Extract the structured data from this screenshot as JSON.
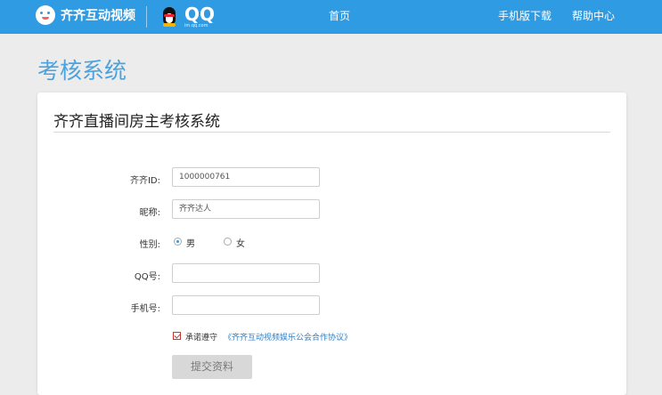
{
  "header": {
    "brand_name": "齐齐互动视频",
    "qq_logo_text": "QQ",
    "qq_logo_sub": "im.qq.com",
    "nav_home": "首页",
    "nav_mobile": "手机版下载",
    "nav_help": "帮助中心",
    "bar_color": "#2f9be2"
  },
  "page": {
    "title": "考核系统"
  },
  "card": {
    "title": "齐齐直播间房主考核系统"
  },
  "form": {
    "qiqi_id_label": "齐齐ID:",
    "qiqi_id_value": "1000000761",
    "nickname_label": "昵称:",
    "nickname_value": "齐齐达人",
    "gender_label": "性别:",
    "gender_male": "男",
    "gender_female": "女",
    "gender_selected": "男",
    "qq_label": "QQ号:",
    "qq_value": "",
    "phone_label": "手机号:",
    "phone_value": "",
    "agree_checked": true,
    "agree_text": "承诺遵守",
    "agree_link": "《齐齐互动视频娱乐公会合作协议》",
    "submit_label": "提交资料"
  }
}
